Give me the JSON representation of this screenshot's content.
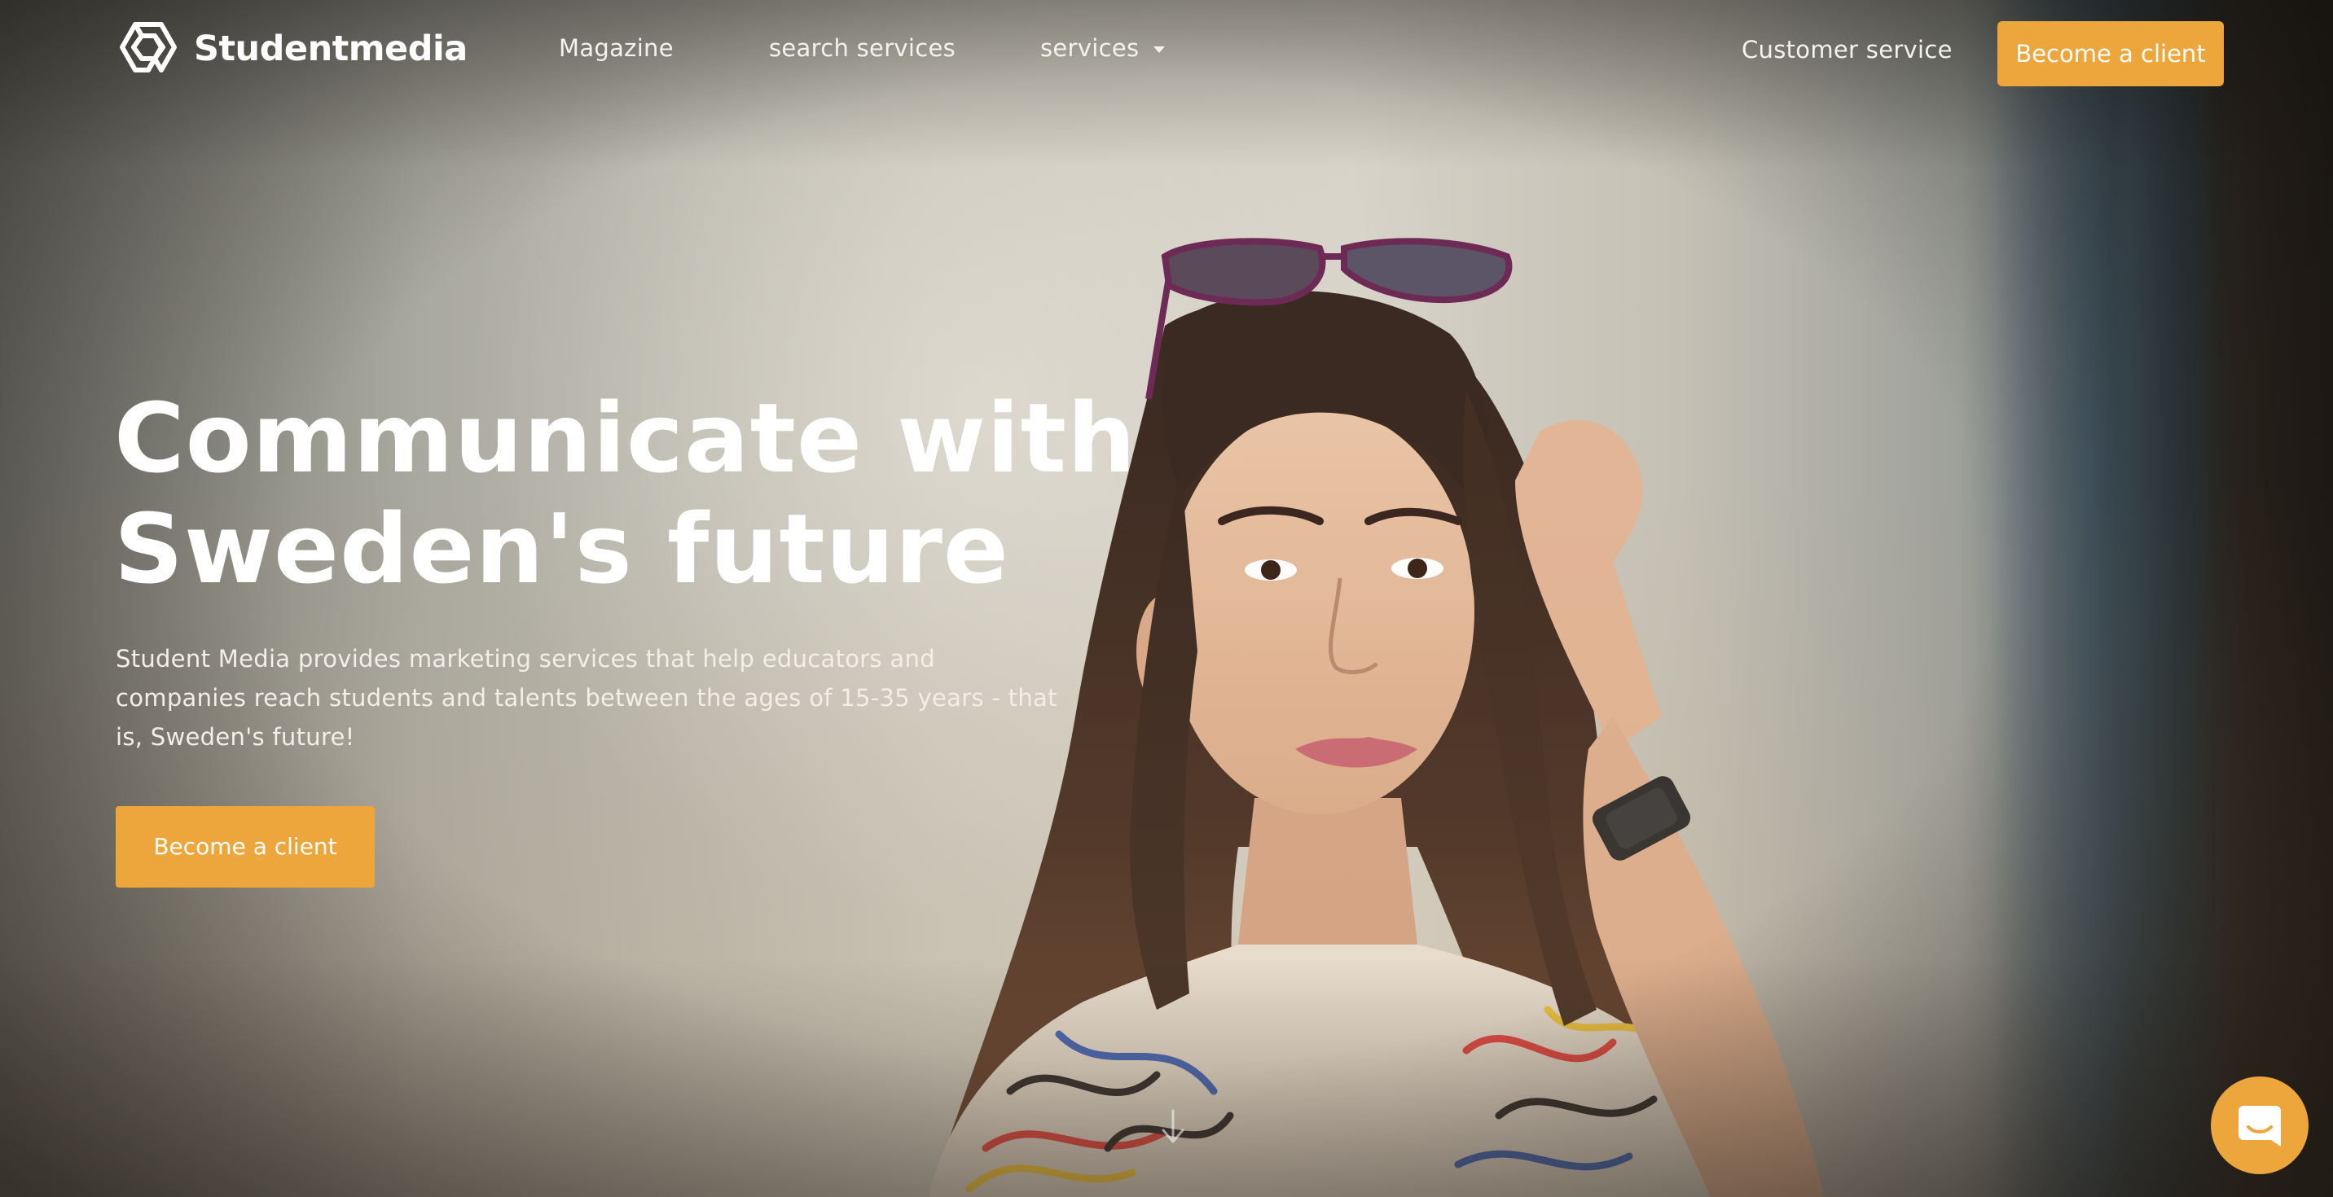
{
  "brand": {
    "name": "Studentmedia",
    "logo_icon": "studentmedia-knot-logo"
  },
  "nav": {
    "items": [
      {
        "label": "Magazine"
      },
      {
        "label": "search services"
      },
      {
        "label": "services",
        "icon": "caret-down-icon"
      }
    ],
    "customer_service": "Customer service",
    "cta": "Become a client"
  },
  "hero": {
    "title_line1": "Communicate with",
    "title_line2": "Sweden's future",
    "description": "Student Media provides marketing services that help educators and companies reach students and talents between the ages of 15-35 years - that is, Sweden's future!",
    "cta": "Become a client",
    "scroll_icon": "chevron-down-icon"
  },
  "chat": {
    "icon": "chat-bubble-icon"
  },
  "colors": {
    "accent": "#eca63c",
    "text": "#ffffff"
  }
}
